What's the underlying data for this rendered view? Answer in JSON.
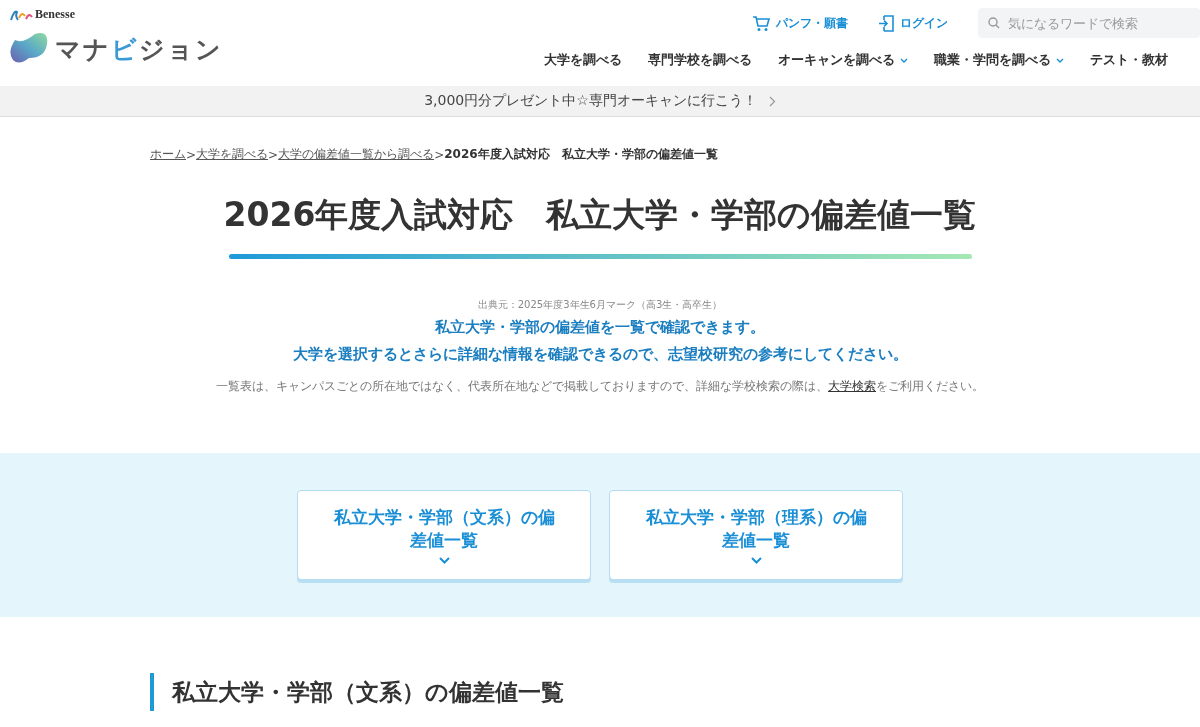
{
  "header": {
    "corporate_logo": "Benesse",
    "brand_logo": [
      {
        "text": "マナ",
        "accent": false
      },
      {
        "text": "ビ",
        "accent": true
      },
      {
        "text": "ジョン",
        "accent": false
      }
    ],
    "utility_links": [
      {
        "kind": "cart",
        "label": "パンフ・願書"
      },
      {
        "kind": "login",
        "label": "ログイン"
      }
    ],
    "search": {
      "placeholder": "気になるワードで検索"
    },
    "nav": [
      {
        "label": "大学を調べる",
        "has_dropdown": false
      },
      {
        "label": "専門学校を調べる",
        "has_dropdown": false
      },
      {
        "label": "オーキャンを調べる",
        "has_dropdown": true
      },
      {
        "label": "職業・学問を調べる",
        "has_dropdown": true
      },
      {
        "label": "テスト・教材",
        "has_dropdown": false
      }
    ]
  },
  "banner": {
    "text": "3,000円分プレゼント中☆専門オーキャンに行こう！"
  },
  "breadcrumb": {
    "links": [
      "ホーム",
      "大学を調べる",
      "大学の偏差値一覧から調べる"
    ],
    "separator": ">",
    "current": "2026年度入試対応　私立大学・学部の偏差値一覧"
  },
  "title": "2026年度入試対応　私立大学・学部の偏差値一覧",
  "source": "出典元：2025年度3年生6月マーク（高3生・高卒生）",
  "lead": [
    "私立大学・学部の偏差値を一覧で確認できます。",
    "大学を選択するとさらに詳細な情報を確認できるので、志望校研究の参考にしてください。"
  ],
  "note": {
    "before": "一覧表は、キャンパスごとの所在地ではなく、代表所在地などで掲載しておりますので、詳細な学校検索の際は、",
    "link": "大学検索",
    "after": "をご利用ください。"
  },
  "jump_buttons": [
    "私立大学・学部（文系）の偏差値一覧",
    "私立大学・学部（理系）の偏差値一覧"
  ],
  "section_heading": "私立大学・学部（文系）の偏差値一覧"
}
